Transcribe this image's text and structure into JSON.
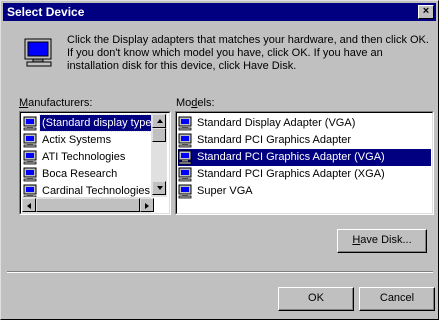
{
  "window": {
    "title": "Select Device",
    "close_glyph": "×"
  },
  "info": {
    "icon": "monitor-icon",
    "text": "Click the Display adapters that matches your hardware, and then click OK. If you don't know which model you have, click OK. If you have an installation disk for this device, click Have Disk."
  },
  "manufacturers": {
    "label_prefix": "",
    "label_accel": "M",
    "label_rest": "anufacturers:",
    "items": [
      {
        "label": "(Standard display types)",
        "selected": true
      },
      {
        "label": "Actix Systems",
        "selected": false
      },
      {
        "label": "ATI Technologies",
        "selected": false
      },
      {
        "label": "Boca Research",
        "selected": false
      },
      {
        "label": "Cardinal Technologies",
        "selected": false
      }
    ]
  },
  "models": {
    "label_prefix": "Mo",
    "label_accel": "d",
    "label_rest": "els:",
    "items": [
      {
        "label": "Standard Display Adapter (VGA)",
        "selected": false
      },
      {
        "label": "Standard PCI Graphics Adapter",
        "selected": false
      },
      {
        "label": "Standard PCI Graphics Adapter (VGA)",
        "selected": true
      },
      {
        "label": "Standard PCI Graphics Adapter (XGA)",
        "selected": false
      },
      {
        "label": "Super VGA",
        "selected": false
      }
    ]
  },
  "buttons": {
    "have_disk_accel": "H",
    "have_disk_rest": "ave Disk...",
    "ok": "OK",
    "cancel": "Cancel"
  },
  "colors": {
    "face": "#c0c0c0",
    "title_bar": "#000080",
    "selection": "#000080"
  }
}
